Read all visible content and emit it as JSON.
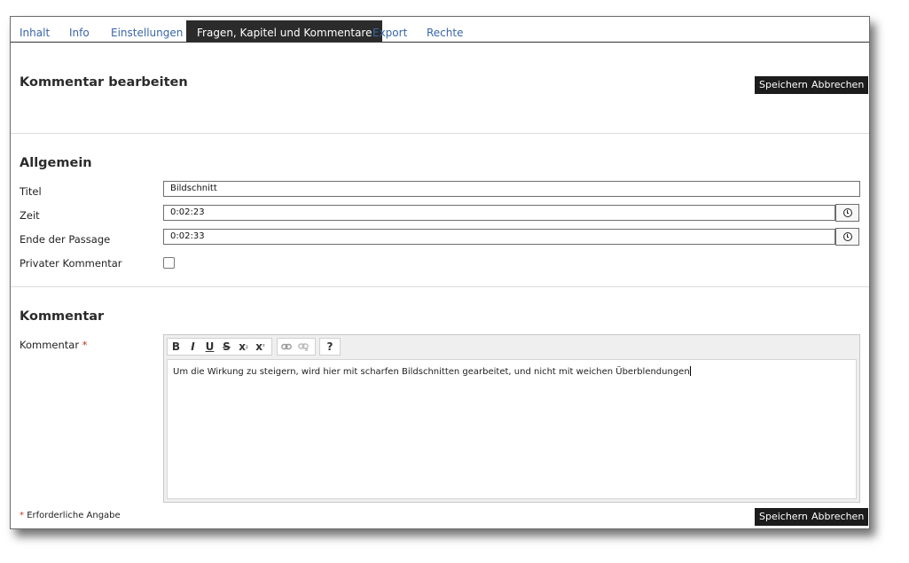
{
  "tabs": [
    {
      "label": "Inhalt"
    },
    {
      "label": "Info"
    },
    {
      "label": "Einstellungen"
    },
    {
      "label": "Fragen, Kapitel und Kommentare",
      "active": true
    },
    {
      "label": "Export"
    },
    {
      "label": "Rechte"
    }
  ],
  "header": {
    "title": "Kommentar bearbeiten",
    "save_label": "Speichern",
    "cancel_label": "Abbrechen"
  },
  "general": {
    "section_title": "Allgemein",
    "title_label": "Titel",
    "title_value": "Bildschnitt",
    "time_label": "Zeit",
    "time_value": "0:02:23",
    "end_label": "Ende der Passage",
    "end_value": "0:02:33",
    "private_label": "Privater Kommentar",
    "private_checked": false
  },
  "comment": {
    "section_title": "Kommentar",
    "label": "Kommentar",
    "required_marker": "*",
    "text": "Um die Wirkung zu steigern, wird hier mit scharfen Bildschnitten gearbeitet, und nicht mit weichen Überblendungen",
    "toolbar": {
      "bold": "B",
      "italic": "I",
      "underline": "U",
      "strike": "S",
      "subscript": "x",
      "superscript": "x",
      "help": "?"
    }
  },
  "footer": {
    "required_marker": "*",
    "required_note": "Erforderliche Angabe",
    "save_label": "Speichern",
    "cancel_label": "Abbrechen"
  },
  "colors": {
    "tab_link": "#3a66a8",
    "tab_active_bg": "#2b2b2b",
    "button_bg": "#1c1c1c",
    "required": "#c0392b"
  }
}
